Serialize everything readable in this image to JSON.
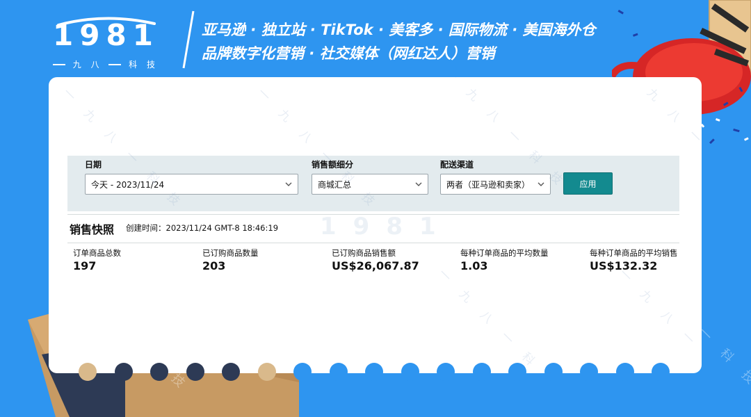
{
  "banner": {
    "logo_number": [
      "1",
      "9",
      "8",
      "1"
    ],
    "logo_subtitle": [
      "一",
      "九",
      "八",
      "一",
      "科",
      "技"
    ],
    "tagline_line1": "亚马逊 · 独立站 · TikTok · 美客多 · 国际物流 · 美国海外仓",
    "tagline_line2": "品牌数字化营销 · 社交媒体（网红达人）营销"
  },
  "watermark": {
    "text": "一 九 八 一 科 技",
    "logo": "1981"
  },
  "filters": {
    "date_label": "日期",
    "date_value": "今天 - 2023/11/24",
    "sales_breakdown_label": "销售额细分",
    "sales_breakdown_value": "商城汇总",
    "fulfillment_label": "配送渠道",
    "fulfillment_value": "两者（亚马逊和卖家）",
    "apply_label": "应用"
  },
  "snapshot": {
    "title": "销售快照",
    "created_label": "创建时间：2023/11/24 GMT-8 18:46:19"
  },
  "metrics": [
    {
      "label": "订单商品总数",
      "value": "197"
    },
    {
      "label": "已订购商品数量",
      "value": "203"
    },
    {
      "label": "已订购商品销售额",
      "value": "US$26,067.87"
    },
    {
      "label": "每种订单商品的平均数量",
      "value": "1.03"
    },
    {
      "label": "每种订单商品的平均销售",
      "value": "US$132.32"
    }
  ],
  "colors": {
    "background": "#2e95f0",
    "card": "#ffffff",
    "filter_bar": "#e3ebee",
    "apply_button": "#138a8f",
    "dot_tan": "#d9b98b",
    "dot_navy": "#2d3a55",
    "dot_blue": "#2e95f0"
  }
}
